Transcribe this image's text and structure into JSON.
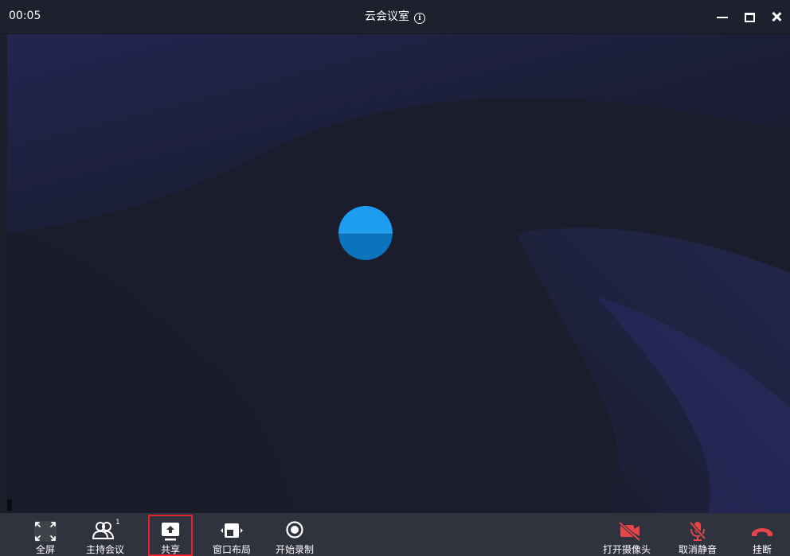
{
  "titlebar": {
    "timer": "00:05",
    "title": "云会议室",
    "info_icon": "info-circle-icon",
    "controls": [
      "minimize-icon",
      "maximize-icon",
      "close-icon"
    ]
  },
  "stage": {
    "avatar_colors": {
      "top": "#1d9cf0",
      "bottom": "#0c74bd"
    }
  },
  "toolbar": {
    "left": [
      {
        "id": "fullscreen",
        "label": "全屏",
        "icon": "fullscreen-icon"
      },
      {
        "id": "host",
        "label": "主持会议",
        "icon": "participants-icon",
        "badge": "1"
      },
      {
        "id": "share",
        "label": "共享",
        "icon": "share-screen-icon"
      },
      {
        "id": "layout",
        "label": "窗口布局",
        "icon": "window-layout-icon"
      },
      {
        "id": "record",
        "label": "开始录制",
        "icon": "record-icon"
      }
    ],
    "right": [
      {
        "id": "camera",
        "label": "打开摄像头",
        "icon": "camera-off-icon"
      },
      {
        "id": "mic",
        "label": "取消静音",
        "icon": "mic-muted-icon"
      },
      {
        "id": "hangup",
        "label": "挂断",
        "icon": "hangup-icon"
      }
    ],
    "colors": {
      "danger": "#e8454a",
      "text": "#ffffff",
      "bar": "#30323d"
    }
  }
}
